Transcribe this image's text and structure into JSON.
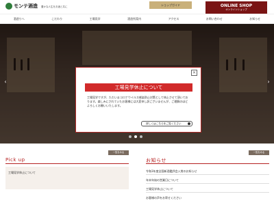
{
  "header": {
    "logo_text": "モンテ酒造",
    "tagline": "豊かな人生をお酒と共に",
    "shop_button": "ショップガイド",
    "online_shop_big": "ONLINE SHOP",
    "online_shop_small": "オンラインショップ"
  },
  "nav": {
    "items": [
      "酒造りへ",
      "こだわり",
      "工場見学",
      "酒造所案内",
      "アクセス",
      "お問い合わせ",
      "お知らせ"
    ]
  },
  "modal": {
    "title": "工場見学休止について",
    "body": "工場見学ですが、ただいまコロナウイルス感染防止対策として休止させて頂いております。楽しみにされていたお客様には大変申し訳ございませんが、ご理解のほどよろしくお願いいたします。",
    "more_link": "詳しくはこちらをご覧ください"
  },
  "pickup": {
    "title": "Pick up",
    "more": "一覧をみる",
    "caption": "工場見学休止について"
  },
  "news": {
    "title": "お知らせ",
    "more": "一覧をみる",
    "items": [
      "令和3年度全国新酒鑑評会入賞のお知らせ",
      "年末年始の営業日について",
      "工場見学休止について",
      "お客様の声をお寄せください"
    ]
  }
}
